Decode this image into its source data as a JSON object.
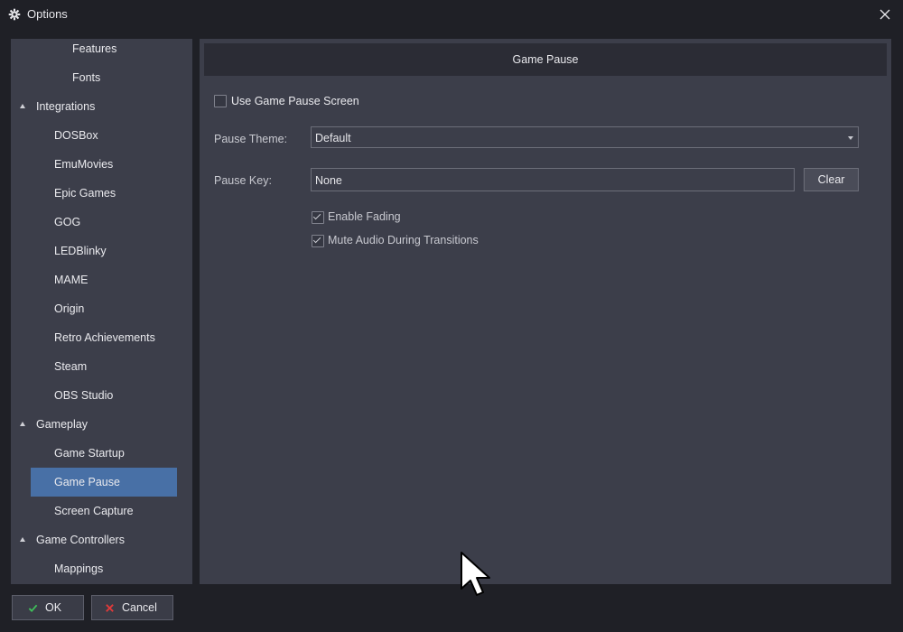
{
  "window": {
    "title": "Options",
    "icon": "gear-icon",
    "close_icon": "close-icon"
  },
  "sidebar": {
    "items": [
      {
        "label": "Features",
        "level": 3
      },
      {
        "label": "Fonts",
        "level": 3
      },
      {
        "label": "Integrations",
        "level": 1,
        "expanded": true
      },
      {
        "label": "DOSBox",
        "level": 2
      },
      {
        "label": "EmuMovies",
        "level": 2
      },
      {
        "label": "Epic Games",
        "level": 2
      },
      {
        "label": "GOG",
        "level": 2
      },
      {
        "label": "LEDBlinky",
        "level": 2
      },
      {
        "label": "MAME",
        "level": 2
      },
      {
        "label": "Origin",
        "level": 2
      },
      {
        "label": "Retro Achievements",
        "level": 2
      },
      {
        "label": "Steam",
        "level": 2
      },
      {
        "label": "OBS Studio",
        "level": 2
      },
      {
        "label": "Gameplay",
        "level": 1,
        "expanded": true
      },
      {
        "label": "Game Startup",
        "level": 2
      },
      {
        "label": "Game Pause",
        "level": 2,
        "selected": true
      },
      {
        "label": "Screen Capture",
        "level": 2
      },
      {
        "label": "Game Controllers",
        "level": 1,
        "expanded": true
      },
      {
        "label": "Mappings",
        "level": 2
      }
    ]
  },
  "content": {
    "header": "Game Pause",
    "use_pause_screen": {
      "label": "Use Game Pause Screen",
      "checked": false
    },
    "pause_theme": {
      "label": "Pause Theme:",
      "value": "Default"
    },
    "pause_key": {
      "label": "Pause Key:",
      "value": "None",
      "clear_label": "Clear"
    },
    "enable_fading": {
      "label": "Enable Fading",
      "checked": true
    },
    "mute_audio": {
      "label": "Mute Audio During Transitions",
      "checked": true
    }
  },
  "footer": {
    "ok_label": "OK",
    "cancel_label": "Cancel"
  },
  "colors": {
    "background": "#1f2026",
    "panel": "#3c3e4a",
    "header": "#2b2c35",
    "selection": "#4870a6",
    "ok_icon": "#3fbf5a",
    "cancel_icon": "#e03a3a"
  }
}
